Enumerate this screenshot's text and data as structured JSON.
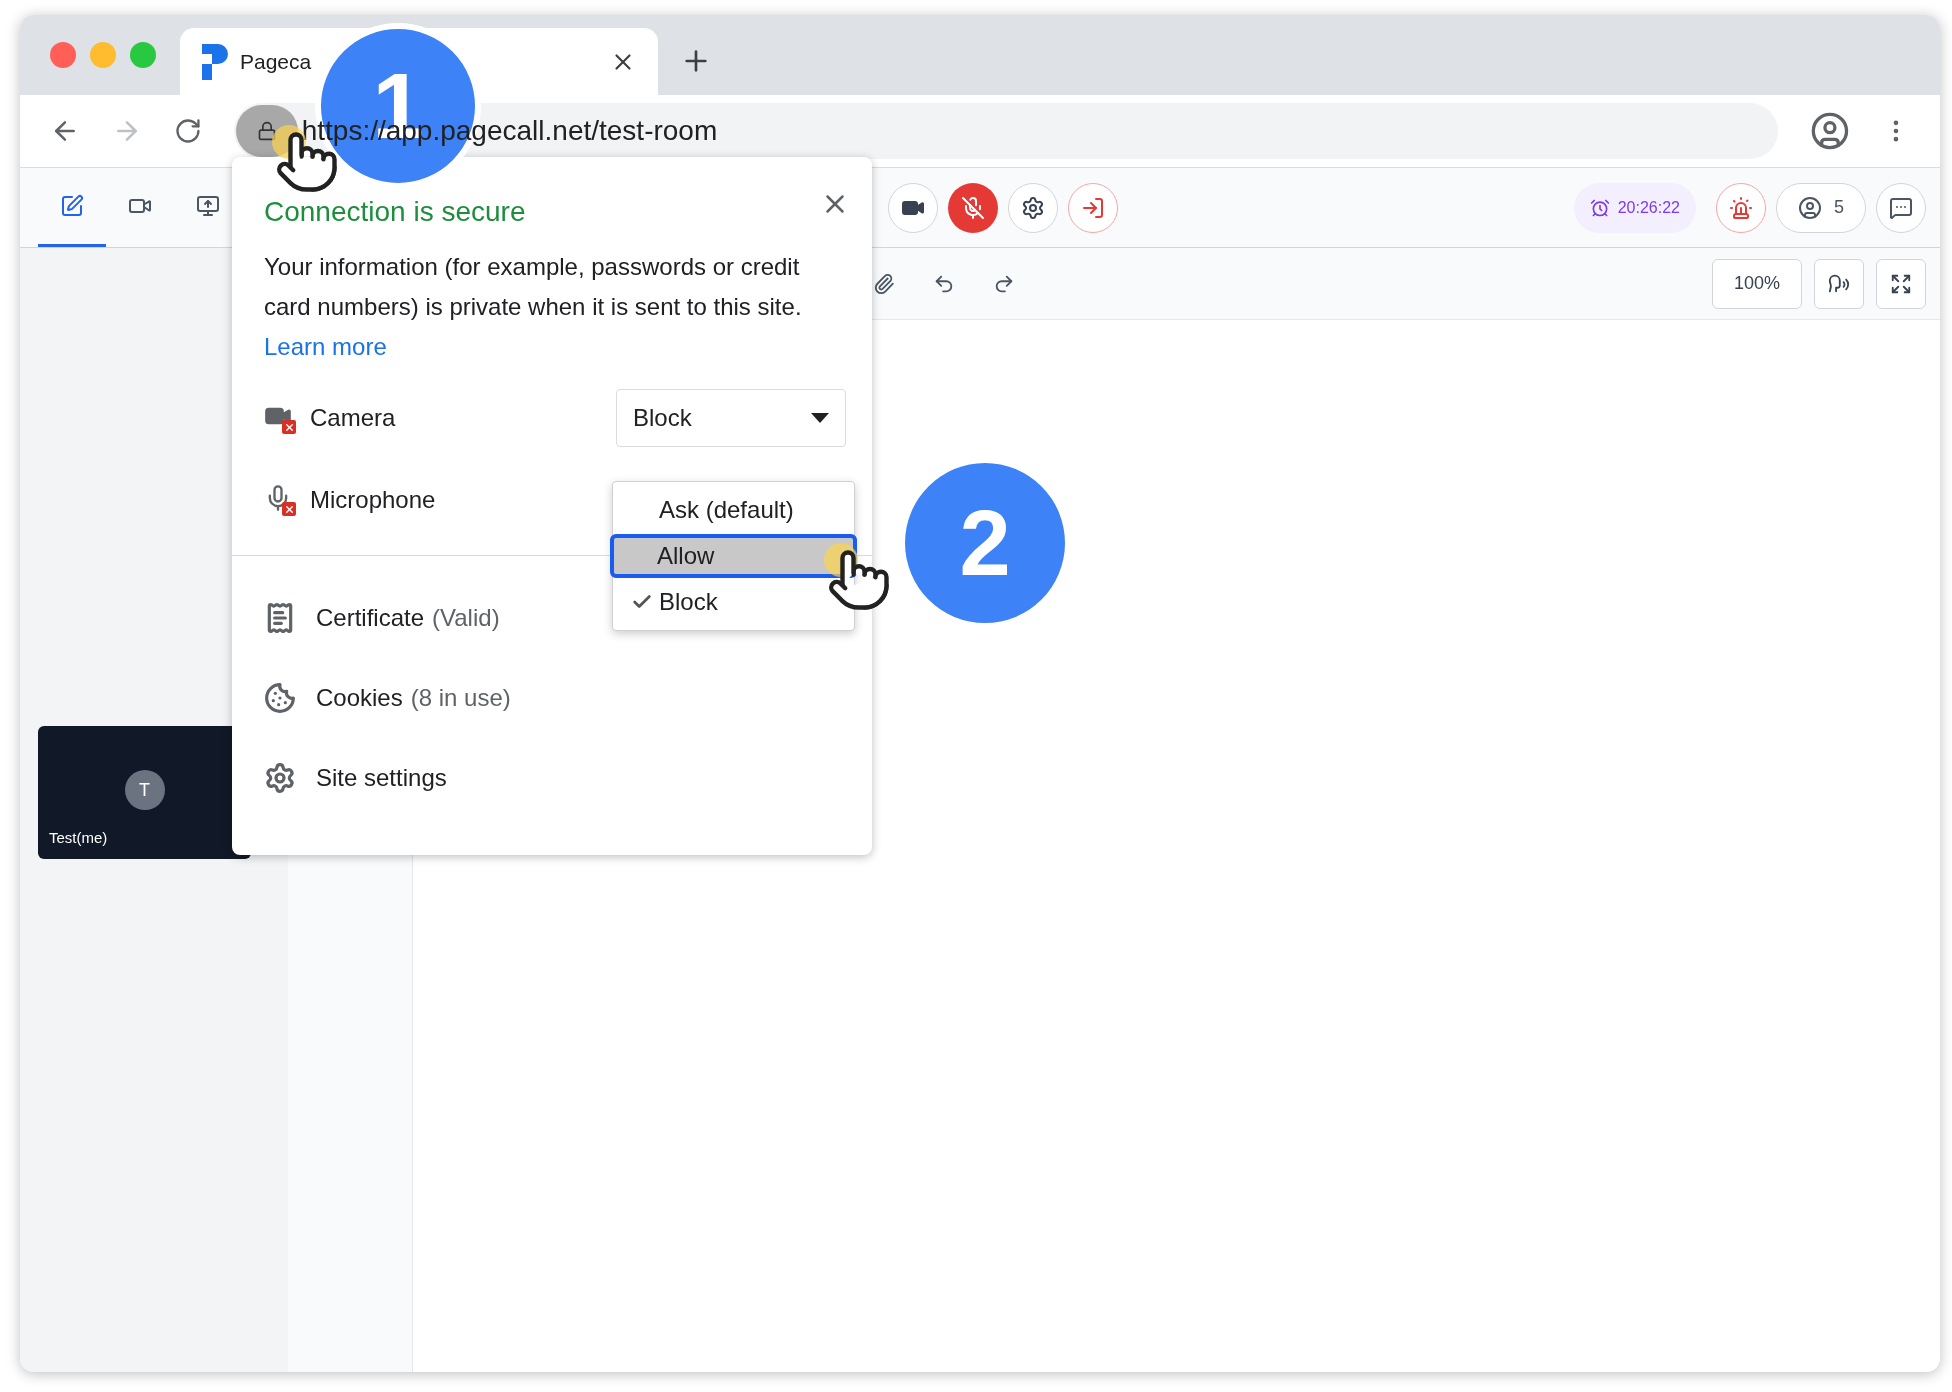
{
  "browser": {
    "tab": {
      "title": "Pageca"
    },
    "url": "https://app.pagecall.net/test-room"
  },
  "app": {
    "side_tabs": [
      {
        "kind": "board",
        "selected": true
      },
      {
        "kind": "video",
        "selected": false
      },
      {
        "kind": "screen",
        "selected": false
      }
    ],
    "mic_muted": true,
    "timer": "20:26:22",
    "participants": "5",
    "zoom": "100%"
  },
  "thumbnail": {
    "initial": "T",
    "name": "Test(me)"
  },
  "popup": {
    "title": "Connection is secure",
    "body": "Your information (for example, passwords or credit card numbers) is private when it is sent to this site.",
    "link": "Learn more",
    "permissions": [
      {
        "kind": "camera",
        "label": "Camera",
        "value": "Block"
      },
      {
        "kind": "microphone",
        "label": "Microphone"
      }
    ],
    "options": [
      {
        "label": "Ask (default)",
        "selected": false,
        "highlighted": false
      },
      {
        "label": "Allow",
        "selected": false,
        "highlighted": true
      },
      {
        "label": "Block",
        "selected": true,
        "highlighted": false
      }
    ],
    "rows": [
      {
        "kind": "certificate",
        "label": "Certificate",
        "detail": "(Valid)"
      },
      {
        "kind": "cookies",
        "label": "Cookies",
        "detail": "(8 in use)"
      },
      {
        "kind": "settings",
        "label": "Site settings"
      }
    ]
  },
  "callouts": [
    "1",
    "2"
  ]
}
